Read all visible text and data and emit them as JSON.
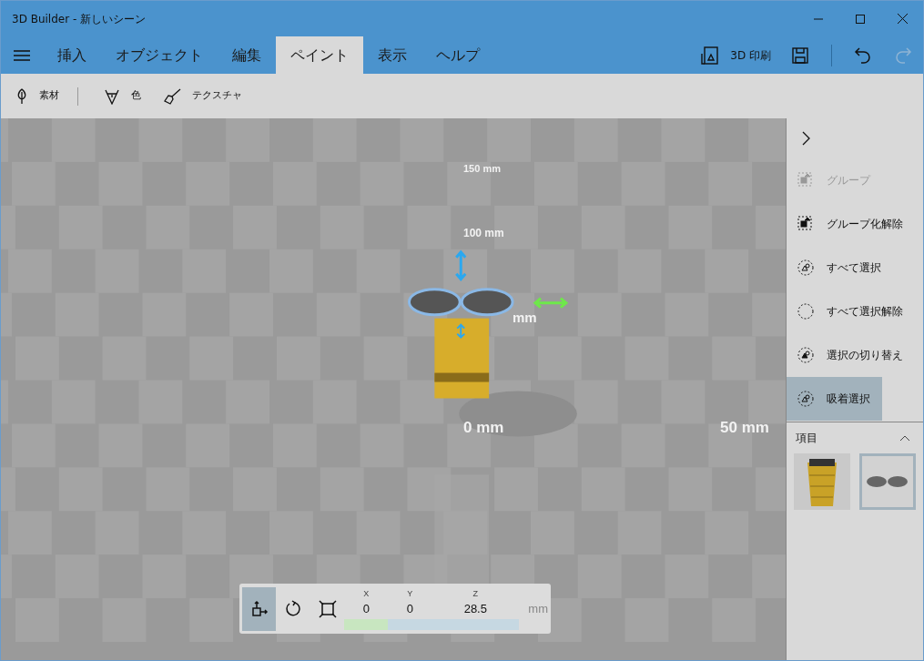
{
  "window": {
    "title": "3D Builder - 新しいシーン"
  },
  "tabs": [
    {
      "label": "挿入",
      "selected": false
    },
    {
      "label": "オブジェクト",
      "selected": false
    },
    {
      "label": "編集",
      "selected": false
    },
    {
      "label": "ペイント",
      "selected": true
    },
    {
      "label": "表示",
      "selected": false
    },
    {
      "label": "ヘルプ",
      "selected": false
    }
  ],
  "header_actions": {
    "print_label": "3D 印刷",
    "redo_disabled": true
  },
  "toolbar": [
    {
      "label": "素材"
    },
    {
      "label": "色"
    },
    {
      "label": "テクスチャ"
    }
  ],
  "viewport": {
    "scale_labels": [
      {
        "text": "150 mm"
      },
      {
        "text": "100 mm"
      },
      {
        "text": "mm"
      },
      {
        "text": "0 mm"
      },
      {
        "text": "50 mm"
      }
    ]
  },
  "side_panel": {
    "items": [
      {
        "label": "グループ",
        "disabled": true,
        "selected": false
      },
      {
        "label": "グループ化解除",
        "disabled": false,
        "selected": false
      },
      {
        "label": "すべて選択",
        "disabled": false,
        "selected": false
      },
      {
        "label": "すべて選択解除",
        "disabled": false,
        "selected": false
      },
      {
        "label": "選択の切り替え",
        "disabled": false,
        "selected": false
      },
      {
        "label": "吸着選択",
        "disabled": false,
        "selected": true
      }
    ],
    "objects_header": "項目",
    "objects_expanded": true,
    "objects": [
      {
        "selected": false
      },
      {
        "selected": true
      }
    ]
  },
  "transform_bar": {
    "modes": [
      {
        "selected": true
      },
      {
        "selected": false
      },
      {
        "selected": false
      }
    ],
    "coords": [
      {
        "axis": "X",
        "value": "0"
      },
      {
        "axis": "Y",
        "value": "0"
      },
      {
        "axis": "Z",
        "value": "28.5"
      }
    ],
    "unit": "mm"
  }
}
